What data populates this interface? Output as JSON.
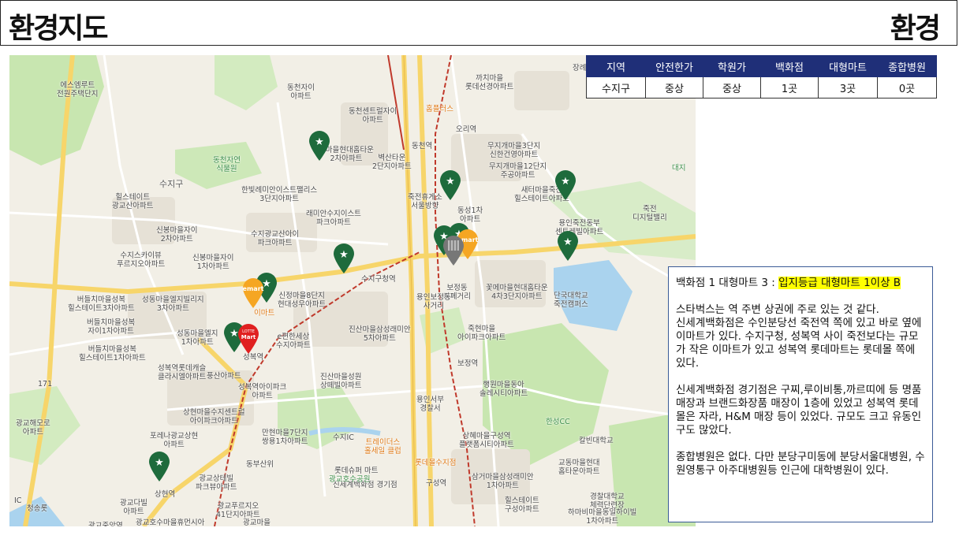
{
  "header": {
    "title_left": "환경지도",
    "title_right": "환경"
  },
  "table": {
    "headers": [
      "지역",
      "안전한가",
      "학원가",
      "백화점",
      "대형마트",
      "종합병원"
    ],
    "row": [
      "수지구",
      "중상",
      "중상",
      "1곳",
      "3곳",
      "0곳"
    ]
  },
  "notes": {
    "line1_prefix": "백화점 1 대형마트 3 : ",
    "line1_highlight": "입지등급 대형마트 1이상 B",
    "p1": "스타벅스는 역 주변 상권에 주로 있는 것 같다.",
    "p2": "신세계백화점은 수인분당선 죽전역 쪽에 있고 바로 옆에 이마트가 있다. 수지구청, 성복역 사이 죽전보다는 규모가 작은 이마트가 있고 성복역 롯데마트는 롯데몰 쪽에 있다.",
    "p3": "신세계백화점 경기점은 구찌,루이비통,까르띠에 등 명품매장과 브랜드화장품 매장이 1층에 있었고 성복역 롯데몰은 자라, H&M 매장 등이 있었다. 규모도 크고 유동인구도 많았다.",
    "p4": "종합병원은 없다. 다만 분당구미동에 분당서울대병원, 수원영통구 아주대병원등 인근에 대학병원이 있다."
  },
  "map": {
    "labels": [
      {
        "text": "에스엠루트\n전원주택단지"
      },
      {
        "text": "동천자이\n아파트"
      },
      {
        "text": "까치마을\n롯데선경아파트"
      },
      {
        "text": "동천센트럴자이\n아파트"
      },
      {
        "text": "홈플러스"
      },
      {
        "text": "오리역"
      },
      {
        "text": "장례식장"
      },
      {
        "text": "동천역"
      },
      {
        "text": "무지개마을3단지\n신한건영아파트"
      },
      {
        "text": "천마을현대홈타운\n2차아파트"
      },
      {
        "text": "벽산타운\n2단지아파트"
      },
      {
        "text": "무지개마을12단지\n주공아파트"
      },
      {
        "text": "동천자연\n식물원"
      },
      {
        "text": "대지"
      },
      {
        "text": "수지구"
      },
      {
        "text": "힐스테이트\n광교산아파트"
      },
      {
        "text": "한빛례미안이스트팰리스\n3단지아파트"
      },
      {
        "text": "죽전휴게소\n서울방향"
      },
      {
        "text": "동성1차\n아파트"
      },
      {
        "text": "새터마을죽전\n힐스테이트아파트"
      },
      {
        "text": "죽전\n디지털밸리"
      },
      {
        "text": "래미안수지이스트\n파크아파트"
      },
      {
        "text": "용인죽전동부\n센트레빌아파트"
      },
      {
        "text": "신봉마을자이\n2차아파트"
      },
      {
        "text": "수지광교산아이\n파크아파트"
      },
      {
        "text": "수지스카이뷰\n푸르지오아파트"
      },
      {
        "text": "신봉마을자이\n1차아파트"
      },
      {
        "text": "수지구청역"
      },
      {
        "text": "꽃메마을현대홈타운\n4차3단지아파트"
      },
      {
        "text": "보정동\n카페거리"
      },
      {
        "text": "단국대학교\n죽전캠퍼스"
      },
      {
        "text": "버들치마을성복\n힐스테이트3차아파트"
      },
      {
        "text": "성동마을엘지빌리지\n3차아파트"
      },
      {
        "text": "신정마을8단지\n현대성우아파트"
      },
      {
        "text": "이마트"
      },
      {
        "text": "버들치마을성복\n자이1차아파트"
      },
      {
        "text": "진산마을삼성래미안\n5차아파트"
      },
      {
        "text": "죽현마을\n아이파크아파트"
      },
      {
        "text": "성동마을엘지\n1차아파트"
      },
      {
        "text": "e편한세상\n수지아파트"
      },
      {
        "text": "버들치마을성복\n힐스테이트1차아파트"
      },
      {
        "text": "성복역"
      },
      {
        "text": "성복역롯데캐슬\n클라시엘아파트"
      },
      {
        "text": "진산마을성원\n상떼빌아파트"
      },
      {
        "text": "보정역"
      },
      {
        "text": "풍산아파트"
      },
      {
        "text": "성복역아이파크\n아파트"
      },
      {
        "text": "행원마을동아\n솔레시티아파트"
      },
      {
        "text": "용인서부\n경찰서"
      },
      {
        "text": "상현마을수지센트럴\n아이파크아파트"
      },
      {
        "text": "광교해모로\n아파트"
      },
      {
        "text": "포레나광교상현\n아파트"
      },
      {
        "text": "만현마을7단지\n쌍용1차아파트"
      },
      {
        "text": "수지IC"
      },
      {
        "text": "트레이더스\n홀세일 클럽"
      },
      {
        "text": "상혜마을구성역\n플랫폼시티아파트"
      },
      {
        "text": "한성CC"
      },
      {
        "text": "칼빈대학교"
      },
      {
        "text": "롯데몰수지점"
      },
      {
        "text": "롯데슈퍼 마트"
      },
      {
        "text": "신세계백화점 경기점"
      },
      {
        "text": "광교상테빌\n파크뷰아파트"
      },
      {
        "text": "상현역"
      },
      {
        "text": "광교다빌\n아파트"
      },
      {
        "text": "광교중앙역"
      },
      {
        "text": "광교푸르지오\n41단지아파트"
      },
      {
        "text": "광교호수마을휴먼시아"
      },
      {
        "text": "광교마을"
      },
      {
        "text": "구성역"
      },
      {
        "text": "삼거마을삼성래미안\n1차아파트"
      },
      {
        "text": "힐스테이트\n구성아파트"
      },
      {
        "text": "교동마을현대\n홈타운아파트"
      },
      {
        "text": "경찰대학교\n체력단련장"
      },
      {
        "text": "하마비마을동일하이빌\n1차아파트"
      },
      {
        "text": "청송롯"
      },
      {
        "text": "광교호수공원"
      },
      {
        "text": "용인보정동\n사거리"
      },
      {
        "text": "171"
      },
      {
        "text": "동부산위"
      },
      {
        "text": "IC"
      }
    ],
    "pins": [
      {
        "icon": "starbucks-pin-icon"
      },
      {
        "icon": "starbucks-pin-icon"
      },
      {
        "icon": "starbucks-pin-icon"
      },
      {
        "icon": "starbucks-pin-icon"
      },
      {
        "icon": "starbucks-pin-icon"
      },
      {
        "icon": "starbucks-pin-icon"
      },
      {
        "icon": "starbucks-pin-icon"
      },
      {
        "icon": "starbucks-pin-icon"
      },
      {
        "icon": "starbucks-pin-icon"
      },
      {
        "icon": "starbucks-pin-icon"
      },
      {
        "icon": "emart-pin-icon",
        "label": "emart"
      },
      {
        "icon": "emart-pin-icon",
        "label": "emart"
      },
      {
        "icon": "lotte-mart-pin-icon",
        "label": "LOTTE Mart"
      },
      {
        "icon": "department-store-pin-icon"
      }
    ],
    "colors": {
      "starbucks": "#1e6b3c",
      "emart": "#f5a623",
      "lotte": "#e02020",
      "park": "#c8e6b0",
      "water": "#aad3ee",
      "road_main": "#f7d56a",
      "road_minor": "#ffffff",
      "rail": "#c0392b"
    }
  }
}
